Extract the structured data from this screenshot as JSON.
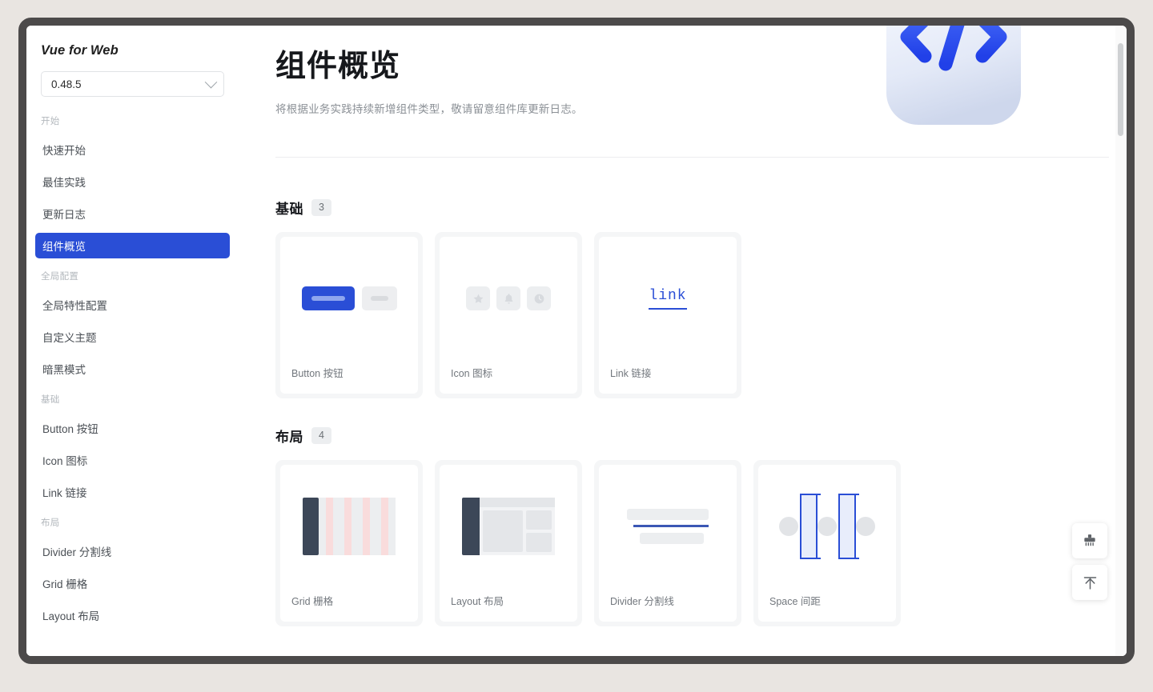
{
  "window": {
    "frame_color": "#4c4a4a",
    "desktop_background": "#e9e5e1"
  },
  "sidebar": {
    "brand": "Vue for Web",
    "version": {
      "value": "0.48.5",
      "icon": "chevron-down-icon"
    },
    "groups": [
      {
        "title": "开始",
        "items": [
          {
            "label": "快速开始",
            "active": false
          },
          {
            "label": "最佳实践",
            "active": false
          },
          {
            "label": "更新日志",
            "active": false
          },
          {
            "label": "组件概览",
            "active": true
          }
        ]
      },
      {
        "title": "全局配置",
        "items": [
          {
            "label": "全局特性配置",
            "active": false
          },
          {
            "label": "自定义主题",
            "active": false
          },
          {
            "label": "暗黑模式",
            "active": false
          }
        ]
      },
      {
        "title": "基础",
        "items": [
          {
            "label": "Button 按钮",
            "active": false
          },
          {
            "label": "Icon 图标",
            "active": false
          },
          {
            "label": "Link 链接",
            "active": false
          }
        ]
      },
      {
        "title": "布局",
        "items": [
          {
            "label": "Divider 分割线",
            "active": false
          },
          {
            "label": "Grid 栅格",
            "active": false
          },
          {
            "label": "Layout 布局",
            "active": false
          }
        ]
      }
    ],
    "active_color": "#2a4ed6"
  },
  "header": {
    "title": "组件概览",
    "subtitle": "将根据业务实践持续新增组件类型，敬请留意组件库更新日志。",
    "art_icon": "code-brackets-3d-icon"
  },
  "sections": [
    {
      "name": "基础",
      "count": "3",
      "cards": [
        {
          "label": "Button 按钮",
          "preview": "button-preview"
        },
        {
          "label": "Icon 图标",
          "preview": "icon-preview"
        },
        {
          "label": "Link 链接",
          "preview": "link-preview",
          "link_text": "link"
        }
      ]
    },
    {
      "name": "布局",
      "count": "4",
      "cards": [
        {
          "label": "Grid 栅格",
          "preview": "grid-preview"
        },
        {
          "label": "Layout 布局",
          "preview": "layout-preview"
        },
        {
          "label": "Divider 分割线",
          "preview": "divider-preview"
        },
        {
          "label": "Space 间距",
          "preview": "space-preview"
        }
      ]
    }
  ],
  "fabs": [
    {
      "name": "brush-icon"
    },
    {
      "name": "back-to-top-icon"
    }
  ]
}
